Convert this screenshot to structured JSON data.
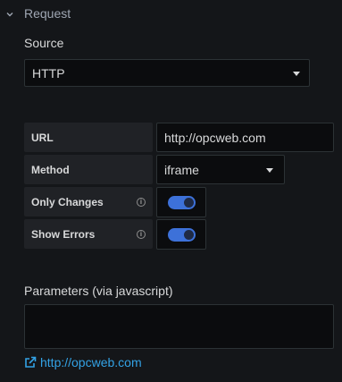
{
  "section": {
    "title": "Request",
    "expanded": true,
    "icon": "chevron-down-icon"
  },
  "source": {
    "label": "Source",
    "value": "HTTP"
  },
  "url": {
    "label": "URL",
    "value": "http://opcweb.com"
  },
  "method": {
    "label": "Method",
    "value": "iframe"
  },
  "only_changes": {
    "label": "Only Changes",
    "enabled": true,
    "info_icon": "info-icon"
  },
  "show_errors": {
    "label": "Show Errors",
    "enabled": true,
    "info_icon": "info-icon"
  },
  "parameters": {
    "label": "Parameters (via javascript)",
    "value": ""
  },
  "link": {
    "text": "http://opcweb.com",
    "icon": "external-link-icon"
  },
  "colors": {
    "background": "#141619",
    "input_bg": "#0b0c0e",
    "label_bg": "#202226",
    "accent": "#3d71d9",
    "link": "#33a2e5"
  }
}
